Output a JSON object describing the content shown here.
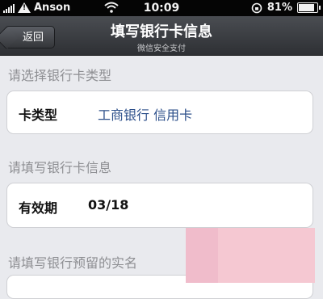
{
  "status_bar": {
    "carrier": "Anson",
    "time": "10:09",
    "battery": "81%"
  },
  "nav": {
    "back_label": "返回",
    "title": "填写银行卡信息",
    "subtitle": "微信安全支付"
  },
  "section1": {
    "label": "请选择银行卡类型",
    "field_label": "卡类型",
    "field_value": "工商银行 信用卡"
  },
  "section2": {
    "label": "请填写银行卡信息",
    "field_label": "有效期",
    "field_value": "03/18"
  },
  "section3": {
    "label": "请填写银行预留的实名"
  }
}
